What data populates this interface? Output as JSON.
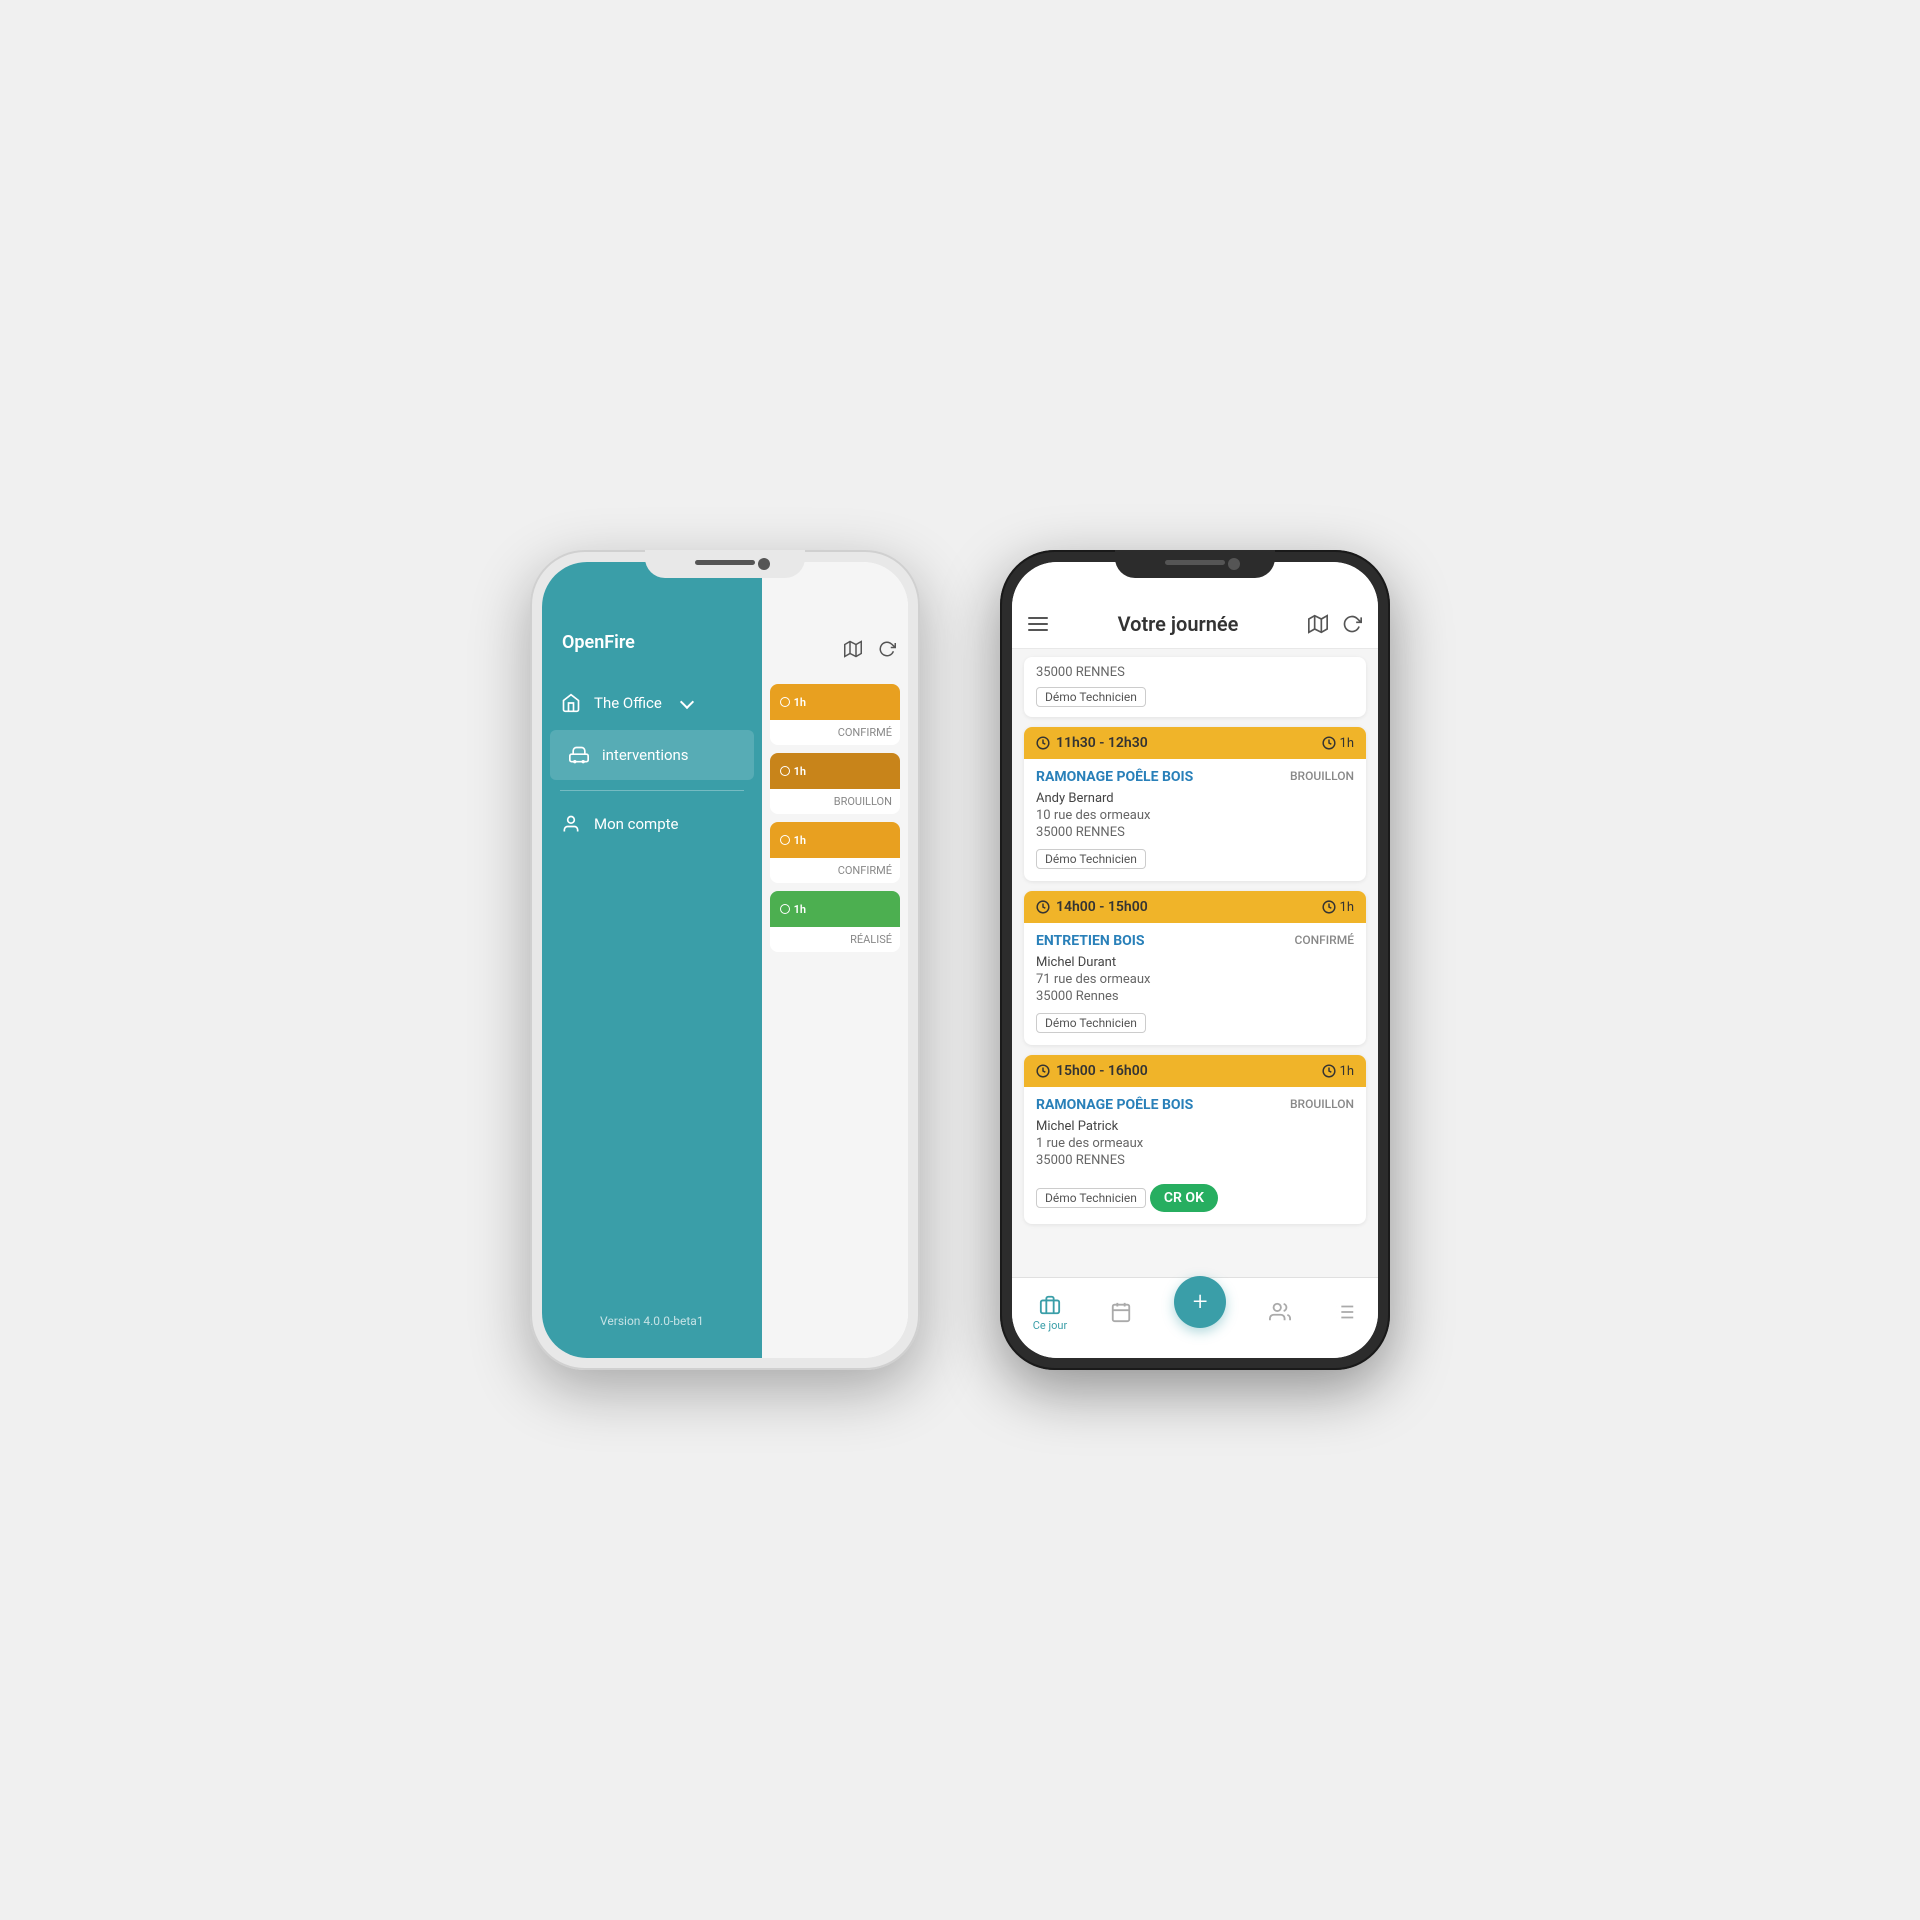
{
  "left_phone": {
    "app_title": "OpenFire",
    "menu_items": [
      {
        "id": "home",
        "label": "The Office",
        "icon": "home",
        "has_chevron": true
      },
      {
        "id": "interventions",
        "label": "interventions",
        "icon": "car",
        "active": true
      },
      {
        "id": "account",
        "label": "Mon compte",
        "icon": "person"
      }
    ],
    "version": "Version 4.0.0-beta1",
    "cards": [
      {
        "time": "1h",
        "status": "CONFIRMÉ",
        "bar_class": "confirmed"
      },
      {
        "time": "1h",
        "status": "BROUILLON",
        "bar_class": "draft"
      },
      {
        "time": "1h",
        "status": "CONFIRMÉ",
        "bar_class": "confirmed2"
      },
      {
        "time": "1h",
        "status": "RÉALISÉ",
        "bar_class": "done"
      }
    ]
  },
  "right_phone": {
    "header": {
      "title": "Votre journée"
    },
    "interventions": [
      {
        "time_range": "11h30 - 12h30",
        "duration": "1h",
        "service": "RAMONAGE POÊLE BOIS",
        "status": "BROUILLON",
        "customer": "Andy Bernard",
        "address_line1": "10 rue des ormeaux",
        "address_line2": "35000 RENNES",
        "tech": "Démo Technicien",
        "cr_ok": false
      },
      {
        "time_range": "14h00 - 15h00",
        "duration": "1h",
        "service": "ENTRETIEN BOIS",
        "status": "CONFIRMÉ",
        "customer": "Michel Durant",
        "address_line1": "71 rue des ormeaux",
        "address_line2": "35000 Rennes",
        "tech": "Démo Technicien",
        "cr_ok": false
      },
      {
        "time_range": "15h00 - 16h00",
        "duration": "1h",
        "service": "RAMONAGE POÊLE BOIS",
        "status": "BROUILLON",
        "customer": "Michel Patrick",
        "address_line1": "1 rue des ormeaux",
        "address_line2": "35000 RENNES",
        "tech": "Démo Technicien",
        "cr_ok": true,
        "cr_label": "CR OK"
      }
    ],
    "bottom_nav": [
      {
        "id": "today",
        "label": "Ce jour",
        "icon": "briefcase",
        "active": true
      },
      {
        "id": "calendar",
        "label": "",
        "icon": "calendar"
      },
      {
        "id": "add",
        "label": "+",
        "icon": "plus",
        "is_fab": true
      },
      {
        "id": "contacts",
        "label": "",
        "icon": "contacts"
      },
      {
        "id": "list",
        "label": "",
        "icon": "list"
      }
    ],
    "partial_card": {
      "address": "35000 RENNES",
      "tech": "Démo Technicien"
    }
  },
  "colors": {
    "teal": "#3a9ea8",
    "gold": "#f0b429",
    "dark_gold": "#c8841a",
    "green": "#27ae60",
    "blue_text": "#2980b9"
  }
}
